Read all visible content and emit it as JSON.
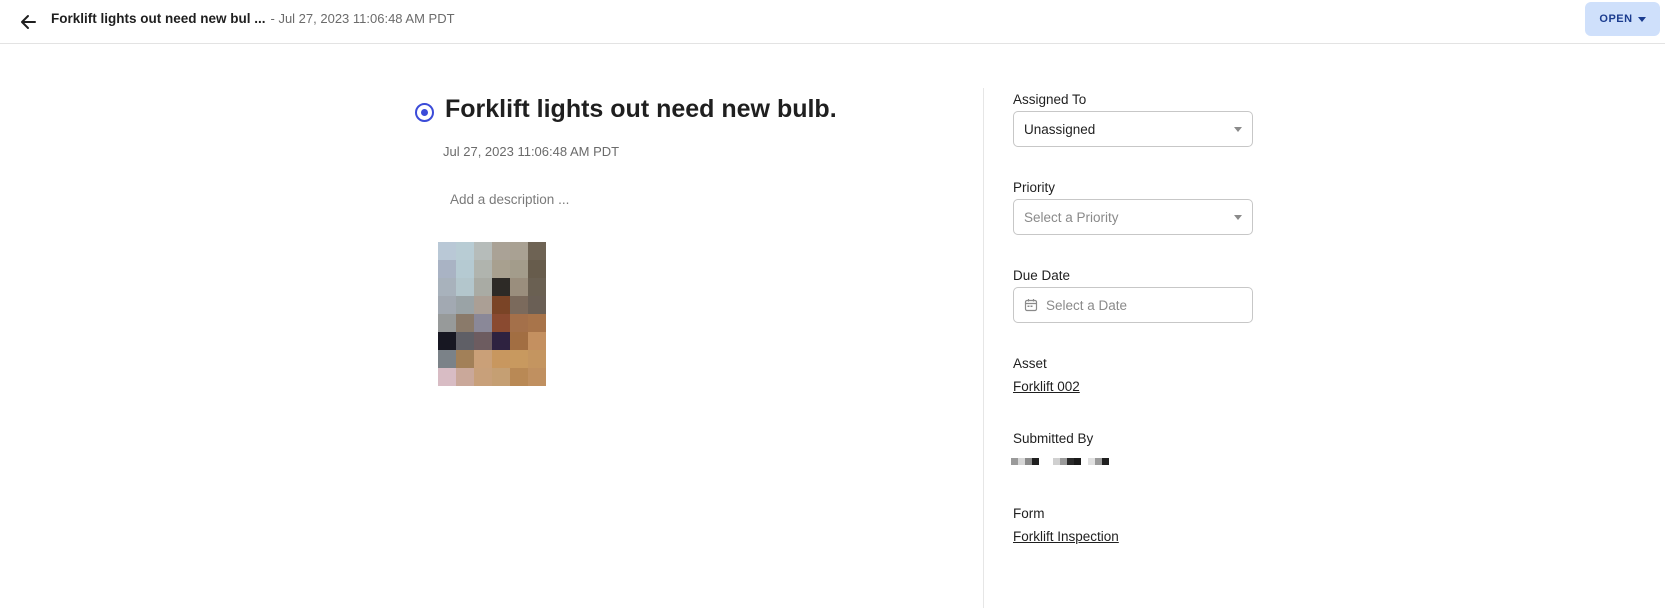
{
  "header": {
    "title": "Forklift lights out need new bul ...",
    "subtitle": "- Jul 27, 2023 11:06:48 AM PDT",
    "status_button": "OPEN"
  },
  "issue": {
    "title": "Forklift lights out need new bulb.",
    "date": "Jul 27, 2023 11:06:48 AM PDT",
    "description_placeholder": "Add a description ..."
  },
  "sidebar": {
    "assigned_to": {
      "label": "Assigned To",
      "value": "Unassigned"
    },
    "priority": {
      "label": "Priority",
      "placeholder": "Select a Priority"
    },
    "due_date": {
      "label": "Due Date",
      "placeholder": "Select a Date"
    },
    "asset": {
      "label": "Asset",
      "value": "Forklift 002"
    },
    "submitted_by": {
      "label": "Submitted By"
    },
    "form": {
      "label": "Form",
      "value": "Forklift Inspection"
    }
  },
  "colors": {
    "accent": "#3b4bd8",
    "open_button_bg": "#cfe0fb",
    "open_button_text": "#1b3c8f"
  },
  "icons": {
    "back": "arrow-left-icon",
    "status": "open-status-icon",
    "calendar": "calendar-icon"
  }
}
